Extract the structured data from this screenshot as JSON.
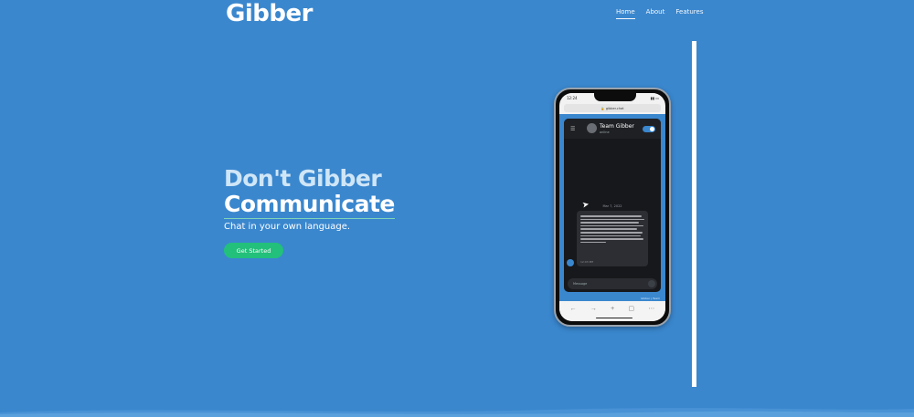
{
  "brand": {
    "logo": "Gibber"
  },
  "nav": [
    {
      "label": "Home",
      "active": true
    },
    {
      "label": "About",
      "active": false
    },
    {
      "label": "Features",
      "active": false
    }
  ],
  "hero": {
    "line1": "Don't Gibber",
    "line2": "Communicate",
    "subtitle": "Chat in your own language.",
    "cta_label": "Get Started"
  },
  "phone": {
    "status_time": "12:24",
    "url": "gibber.chat",
    "chat_title": "Team Gibber",
    "chat_status": "online",
    "date_label": "Mar 7, 2022",
    "bubble_time": "12:03 PM",
    "message_placeholder": "Message",
    "powered_by": "Gibber | Team",
    "browser_icons": [
      "back-icon",
      "forward-icon",
      "add-icon",
      "tabs-icon",
      "more-icon"
    ]
  },
  "colors": {
    "background": "#3a87ce",
    "cta": "#22c07a",
    "text": "#ffffff"
  }
}
